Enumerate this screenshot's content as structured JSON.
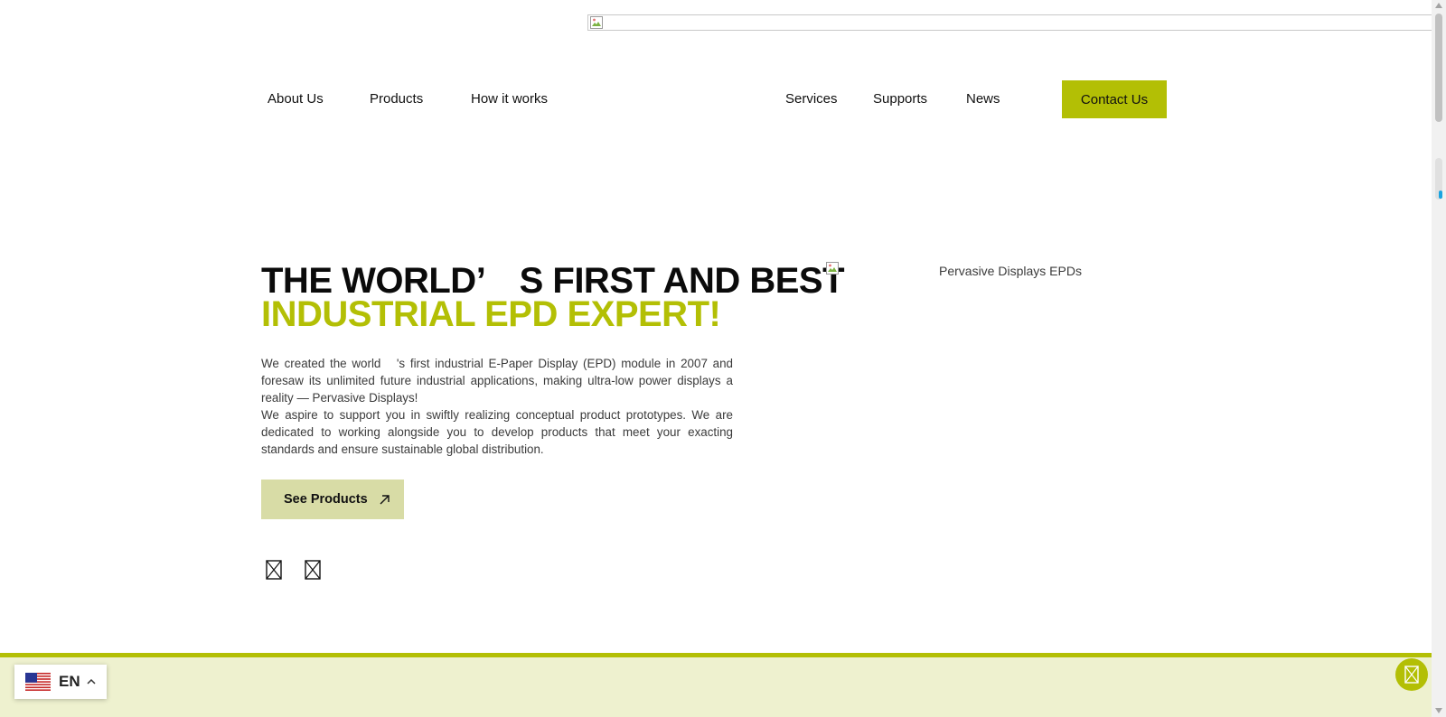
{
  "nav": {
    "left_items": [
      "About Us",
      "Products",
      "How it works"
    ],
    "right_items": [
      "Services",
      "Supports",
      "News"
    ],
    "contact_label": "Contact Us"
  },
  "hero": {
    "title_line1": "THE WORLD’　S FIRST AND BEST",
    "title_line2": "INDUSTRIAL EPD EXPERT!",
    "paragraph1": "We created the world　's first industrial E-Paper Display (EPD) module in 2007 and foresaw its unlimited future industrial applications, making ultra-low power displays a reality — Pervasive Displays!",
    "paragraph2": "We aspire to support you in swiftly realizing conceptual product prototypes. We are dedicated to working alongside you to develop products that meet your exacting standards and ensure sustainable global distribution.",
    "cta_label": "See Products",
    "image_alt": "Pervasive Displays EPDs"
  },
  "language": {
    "code": "EN",
    "flag_icon": "us-flag-icon"
  },
  "colors": {
    "accent": "#b3bf05",
    "accent_light": "#d8dca6",
    "band": "#eef1cf"
  }
}
